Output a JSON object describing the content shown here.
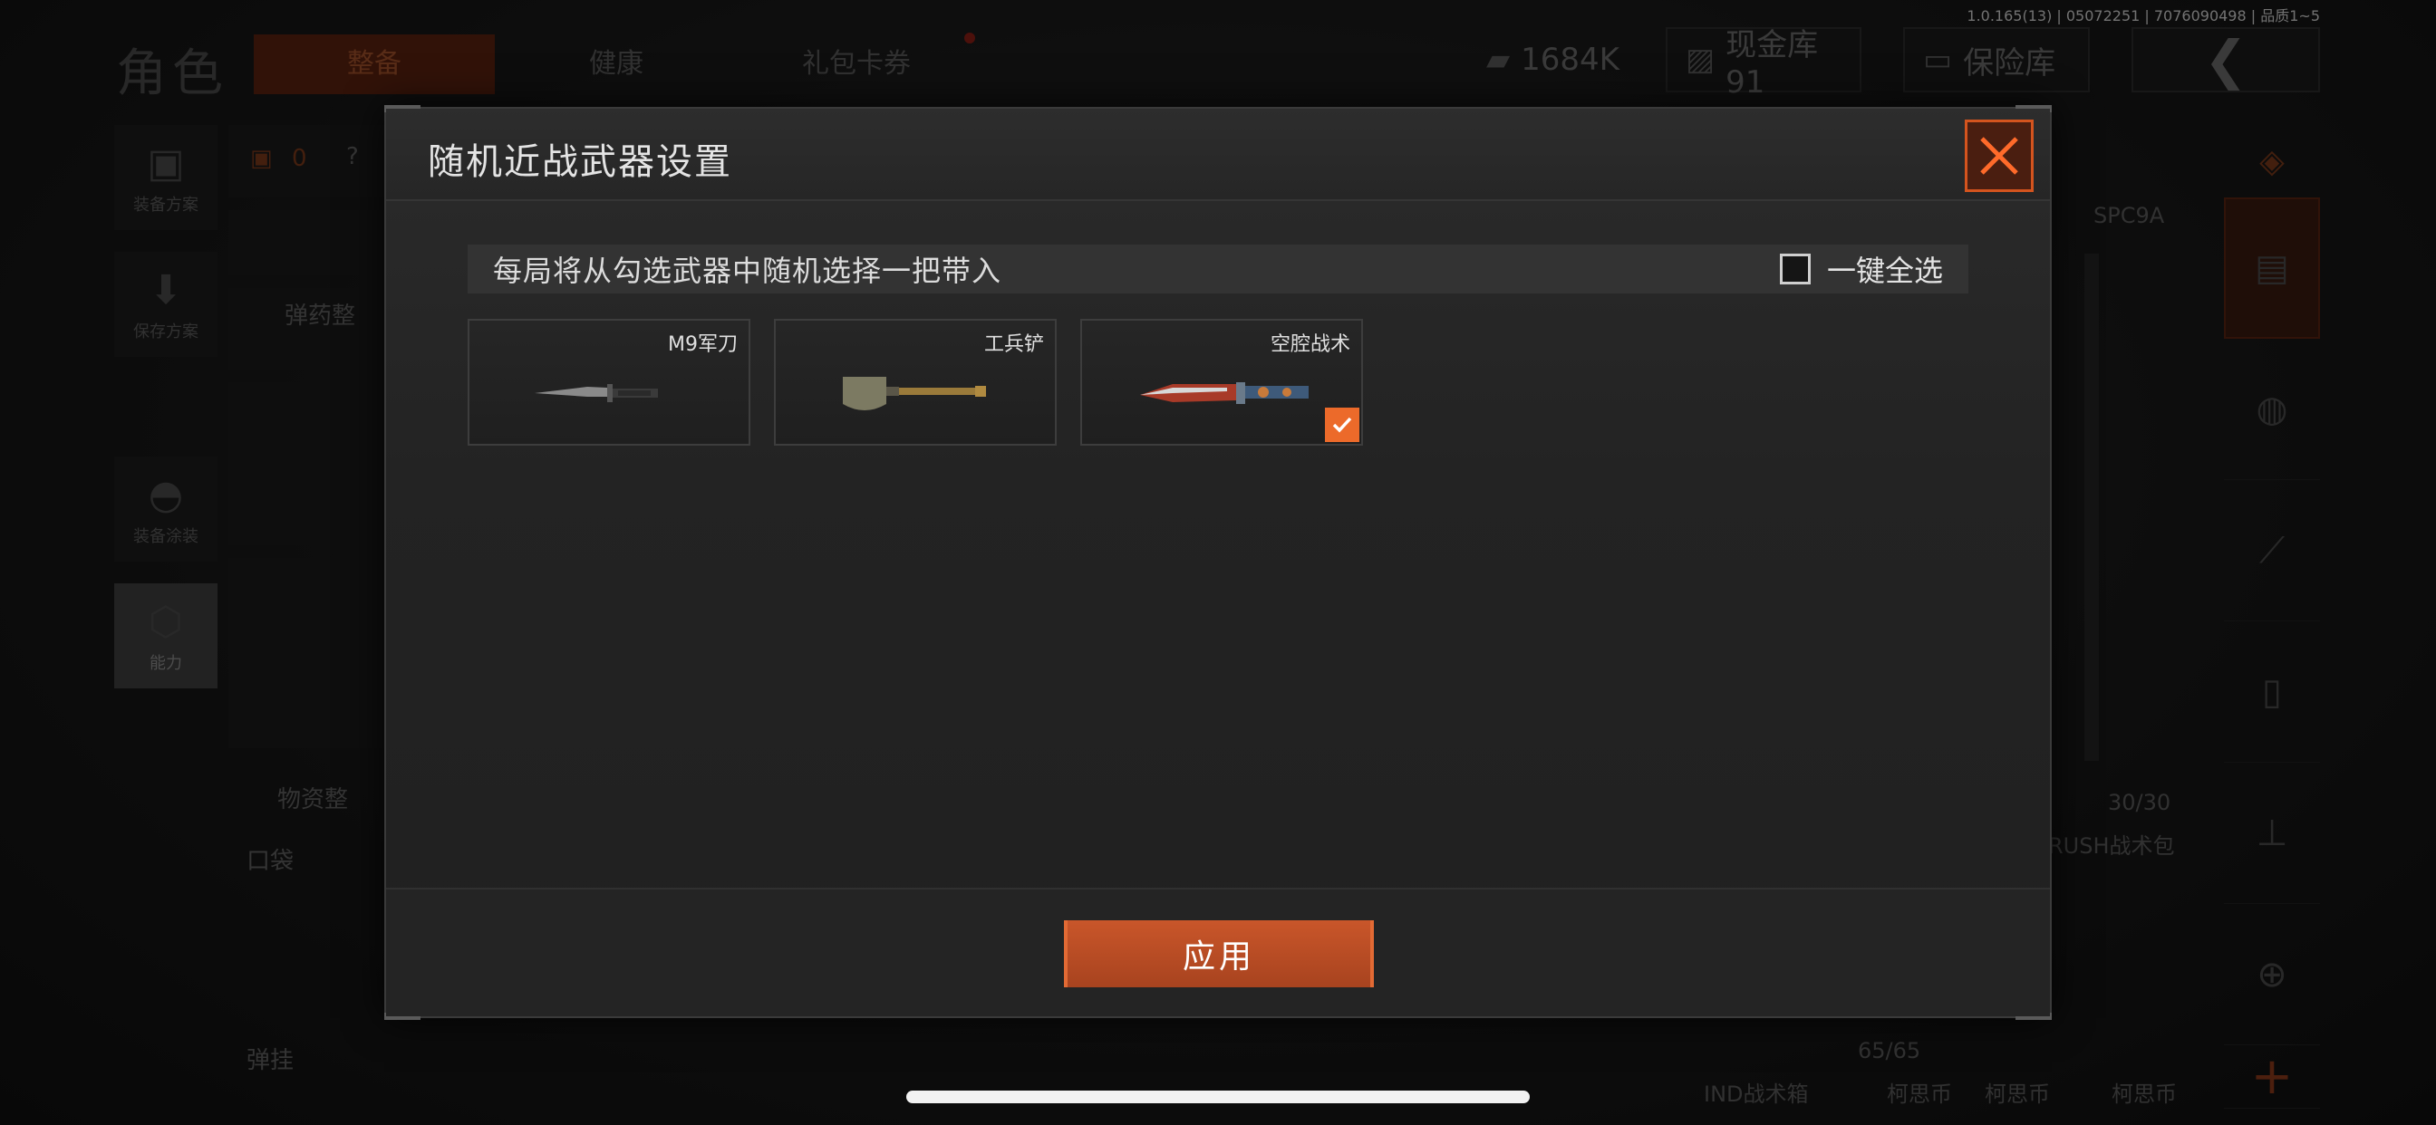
{
  "version": "1.0.165(13) | 05072251 | 7076090498 | 品质1~5",
  "header": {
    "title": "角色",
    "tabs": [
      {
        "label": "整备",
        "active": true
      },
      {
        "label": "健康",
        "active": false
      },
      {
        "label": "礼包卡券",
        "active": false
      }
    ],
    "currency": {
      "icon": "money-stack-icon",
      "value": "1684K"
    },
    "cash_vault": {
      "icon": "cash-vault-icon",
      "label": "现金库 91"
    },
    "safe": {
      "icon": "safe-icon",
      "label": "保险库"
    },
    "back_icon": "back-arrow-icon"
  },
  "left_nav": {
    "items": [
      {
        "label": "装备方案",
        "icon": "vest-icon"
      },
      {
        "label": "保存方案",
        "icon": "download-icon"
      },
      {
        "label": "装备涂装",
        "icon": "helmet-icon"
      },
      {
        "label": "能力",
        "icon": "ability-icon",
        "active": true
      }
    ]
  },
  "left_panel": {
    "armor_count": "0",
    "help": "?",
    "ammo_label": "弹药整",
    "supplies_label": "物资整",
    "pocket_label": "口袋",
    "bandolier_label": "弹挂"
  },
  "background_right": {
    "weapon_name": "SPC9A",
    "ammo": "30/30",
    "bag_name": "RUSH战术包",
    "capacity": "65/65",
    "item1": "IND战术箱",
    "item2": "柯思币",
    "item3": "柯思币",
    "item4": "柯思币"
  },
  "modal": {
    "title": "随机近战武器设置",
    "hint": "每局将从勾选武器中随机选择一把带入",
    "select_all_label": "一键全选",
    "select_all_checked": false,
    "weapons": [
      {
        "name": "M9军刀",
        "icon": "combat-knife-icon",
        "checked": false
      },
      {
        "name": "工兵铲",
        "icon": "shovel-icon",
        "checked": false
      },
      {
        "name": "空腔战术",
        "icon": "tactical-blade-icon",
        "checked": true
      }
    ],
    "apply_label": "应用",
    "colors": {
      "accent": "#ec6a2a",
      "button": "#b84a22",
      "close_border": "#d4541e"
    }
  }
}
